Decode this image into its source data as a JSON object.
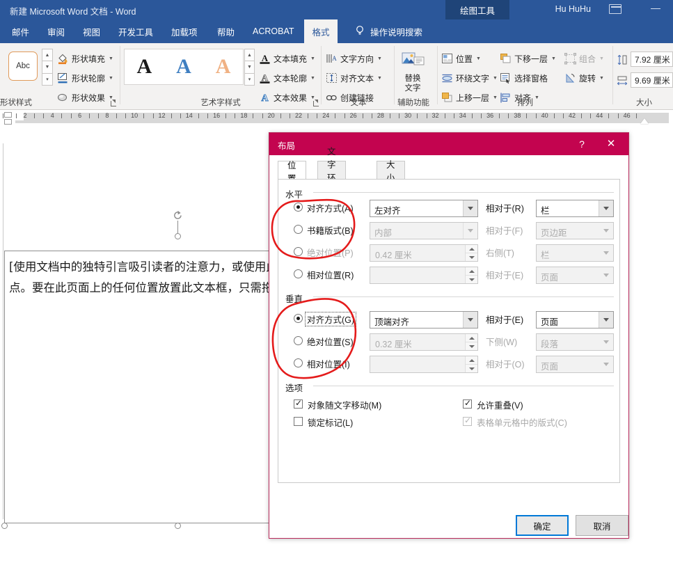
{
  "titlebar": {
    "document_title": "新建 Microsoft Word 文档  -  Word",
    "contextual_tab_label": "绘图工具",
    "user_name": "Hu HuHu",
    "ribbon_display_icon": "ribbon-display-options-icon",
    "minimize_label": "—"
  },
  "tabs": [
    {
      "label": "邮件",
      "active": false
    },
    {
      "label": "审阅",
      "active": false
    },
    {
      "label": "视图",
      "active": false
    },
    {
      "label": "开发工具",
      "active": false
    },
    {
      "label": "加载项",
      "active": false
    },
    {
      "label": "帮助",
      "active": false
    },
    {
      "label": "ACROBAT",
      "active": false
    },
    {
      "label": "格式",
      "active": true
    }
  ],
  "tell_me": {
    "label": "操作说明搜索",
    "icon": "lightbulb-icon"
  },
  "ribbon": {
    "groups": [
      {
        "name": "形状样式",
        "has_launcher": true
      },
      {
        "name": "艺术字样式",
        "has_launcher": true
      },
      {
        "name": "文本",
        "has_launcher": false
      },
      {
        "name": "辅助功能",
        "has_launcher": false
      },
      {
        "name": "排列",
        "has_launcher": false
      },
      {
        "name": "大小",
        "has_launcher": false
      }
    ],
    "shape_styles": {
      "preview_label": "Abc",
      "items": [
        {
          "label": "形状填充",
          "icon": "fill-bucket-icon",
          "dropdown": true
        },
        {
          "label": "形状轮廓",
          "icon": "pen-outline-icon",
          "dropdown": true
        },
        {
          "label": "形状效果",
          "icon": "shape-effects-icon",
          "dropdown": true
        }
      ]
    },
    "wordart_styles": {
      "gallery": [
        "A",
        "A",
        "A"
      ],
      "items": [
        {
          "label": "文本填充",
          "icon": "text-fill-icon",
          "dropdown": true
        },
        {
          "label": "文本轮廓",
          "icon": "text-outline-icon",
          "dropdown": true
        },
        {
          "label": "文本效果",
          "icon": "text-effects-icon",
          "dropdown": true
        }
      ]
    },
    "text_group": {
      "items": [
        {
          "label": "文字方向",
          "icon": "text-direction-icon",
          "dropdown": true
        },
        {
          "label": "对齐文本",
          "icon": "align-text-icon",
          "dropdown": true
        },
        {
          "label": "创建链接",
          "icon": "create-link-icon",
          "dropdown": false
        }
      ]
    },
    "accessibility": {
      "label_line1": "替换",
      "label_line2": "文字",
      "icon": "alt-text-icon"
    },
    "arrange": {
      "items": [
        {
          "label": "位置",
          "icon": "position-icon",
          "dropdown": true,
          "disabled": false
        },
        {
          "label": "环绕文字",
          "icon": "wrap-text-icon",
          "dropdown": true,
          "disabled": false
        },
        {
          "label": "上移一层",
          "icon": "bring-forward-icon",
          "dropdown": true,
          "disabled": false
        },
        {
          "label": "下移一层",
          "icon": "send-backward-icon",
          "dropdown": true,
          "disabled": false
        },
        {
          "label": "选择窗格",
          "icon": "selection-pane-icon",
          "dropdown": false,
          "disabled": false
        },
        {
          "label": "对齐",
          "icon": "align-objects-icon",
          "dropdown": true,
          "disabled": false
        },
        {
          "label": "组合",
          "icon": "group-objects-icon",
          "dropdown": true,
          "disabled": true
        },
        {
          "label": "旋转",
          "icon": "rotate-objects-icon",
          "dropdown": true,
          "disabled": false
        }
      ]
    },
    "size": {
      "height": {
        "value": "7.92 厘米",
        "icon": "shape-height-icon"
      },
      "width": {
        "value": "9.69 厘米",
        "icon": "shape-width-icon"
      }
    }
  },
  "ruler": {
    "ticks": [
      "2",
      "4",
      "6",
      "8",
      "10",
      "12",
      "14",
      "16",
      "18",
      "20",
      "22",
      "24",
      "26",
      "28",
      "30",
      "32",
      "34",
      "36",
      "38",
      "40",
      "42",
      "44",
      "46"
    ]
  },
  "document": {
    "shape_text": "[使用文档中的独特引言吸引读者的注意力，或使用此空间强调要点。要在此页面上的任何位置放置此文本框，只需拖动它即可。]",
    "paragraph_mark": "↵"
  },
  "dialog": {
    "title": "布局",
    "help_label": "?",
    "close_label": "✕",
    "tabs": [
      {
        "label": "位置",
        "active": true
      },
      {
        "label": "文字环绕",
        "active": false
      },
      {
        "label": "大小",
        "active": false
      }
    ],
    "horizontal": {
      "legend": "水平",
      "rows": [
        {
          "radio_label": "对齐方式(A)",
          "radio_accel": "A",
          "selected": true,
          "disabled": false,
          "control_type": "combo",
          "control_value": "左对齐",
          "control_disabled": false,
          "rel_label": "相对于(R)",
          "rel_disabled": false,
          "rel_value": "栏",
          "rel_control_disabled": false
        },
        {
          "radio_label": "书籍版式(B)",
          "radio_accel": "B",
          "selected": false,
          "disabled": false,
          "control_type": "combo",
          "control_value": "内部",
          "control_disabled": true,
          "rel_label": "相对于(F)",
          "rel_disabled": true,
          "rel_value": "页边距",
          "rel_control_disabled": true
        },
        {
          "radio_label": "绝对位置(P)",
          "radio_accel": "P",
          "selected": false,
          "disabled": true,
          "control_type": "spin",
          "control_value": "0.42 厘米",
          "control_disabled": true,
          "rel_label": "右侧(T)",
          "rel_disabled": true,
          "rel_value": "栏",
          "rel_control_disabled": true
        },
        {
          "radio_label": "相对位置(R)",
          "radio_accel": "R",
          "selected": false,
          "disabled": false,
          "control_type": "spin",
          "control_value": "",
          "control_disabled": true,
          "rel_label": "相对于(E)",
          "rel_disabled": true,
          "rel_value": "页面",
          "rel_control_disabled": true
        }
      ]
    },
    "vertical": {
      "legend": "垂直",
      "rows": [
        {
          "radio_label": "对齐方式(G)",
          "radio_accel": "G",
          "selected": true,
          "disabled": false,
          "focused": true,
          "control_type": "combo",
          "control_value": "顶端对齐",
          "control_disabled": false,
          "rel_label": "相对于(E)",
          "rel_disabled": false,
          "rel_value": "页面",
          "rel_control_disabled": false
        },
        {
          "radio_label": "绝对位置(S)",
          "radio_accel": "S",
          "selected": false,
          "disabled": false,
          "focused": false,
          "control_type": "spin",
          "control_value": "0.32 厘米",
          "control_disabled": true,
          "rel_label": "下侧(W)",
          "rel_disabled": true,
          "rel_value": "段落",
          "rel_control_disabled": true
        },
        {
          "radio_label": "相对位置(I)",
          "radio_accel": "I",
          "selected": false,
          "disabled": false,
          "focused": false,
          "control_type": "spin",
          "control_value": "",
          "control_disabled": true,
          "rel_label": "相对于(O)",
          "rel_disabled": true,
          "rel_value": "页面",
          "rel_control_disabled": true
        }
      ]
    },
    "options": {
      "legend": "选项",
      "items": [
        {
          "label": "对象随文字移动(M)",
          "checked": true,
          "disabled": false
        },
        {
          "label": "锁定标记(L)",
          "checked": false,
          "disabled": false
        },
        {
          "label": "允许重叠(V)",
          "checked": true,
          "disabled": false
        },
        {
          "label": "表格单元格中的版式(C)",
          "checked": true,
          "disabled": true
        }
      ]
    },
    "buttons": {
      "ok": "确定",
      "cancel": "取消"
    }
  },
  "annotations": {
    "color": "#e41b1b",
    "marks": [
      {
        "name": "circle-horizontal-alignment",
        "shape": "ellipse"
      },
      {
        "name": "circle-vertical-alignment",
        "shape": "ellipse"
      }
    ]
  },
  "colors": {
    "word_blue": "#2b579a",
    "dialog_magenta": "#c3044f",
    "accent_focus": "#0078d7",
    "annotation_red": "#e41b1b"
  }
}
